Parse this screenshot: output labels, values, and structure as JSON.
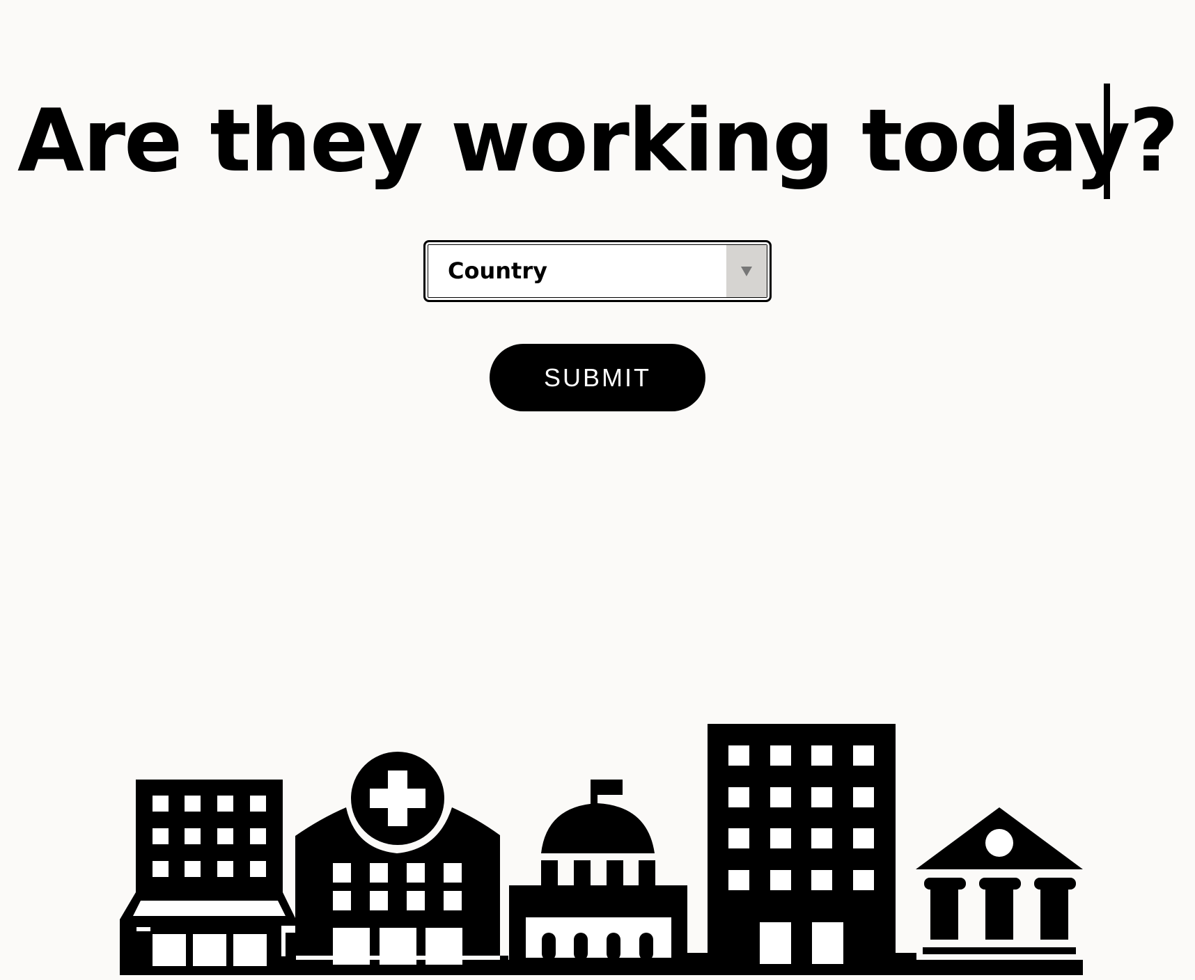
{
  "headline": "Are they working today?",
  "country_select": {
    "value": "Country"
  },
  "submit_button": {
    "label": "SUBMIT"
  },
  "skyline": {
    "buildings": [
      "shop-building-icon",
      "hospital-building-icon",
      "government-dome-building-icon",
      "office-tower-icon",
      "bank-building-icon"
    ]
  }
}
